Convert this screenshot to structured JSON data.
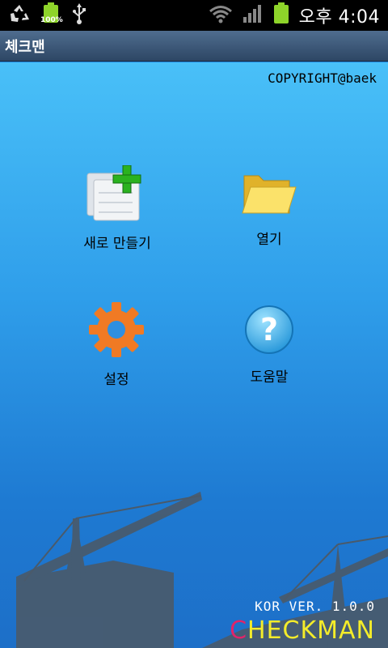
{
  "status_bar": {
    "battery_percent": "100%",
    "clock": "오후 4:04",
    "icons": [
      "recycle-icon",
      "battery-icon",
      "usb-icon",
      "wifi-icon",
      "signal-icon",
      "battery-icon"
    ]
  },
  "app": {
    "title": "체크맨",
    "copyright": "COPYRIGHT@baek"
  },
  "menu": {
    "new": {
      "label": "새로 만들기",
      "icon": "new-document-icon"
    },
    "open": {
      "label": "열기",
      "icon": "folder-icon"
    },
    "settings": {
      "label": "설정",
      "icon": "gear-icon"
    },
    "help": {
      "label": "도움말",
      "icon": "help-icon"
    }
  },
  "footer": {
    "version": "KOR VER. 1.0.0",
    "brand_first": "C",
    "brand_rest": "HECKMAN"
  },
  "colors": {
    "sky_top": "#49c0f8",
    "sky_bottom": "#1d6fc8",
    "brand_c": "#e0246a",
    "brand_rest": "#f4ec2a"
  }
}
